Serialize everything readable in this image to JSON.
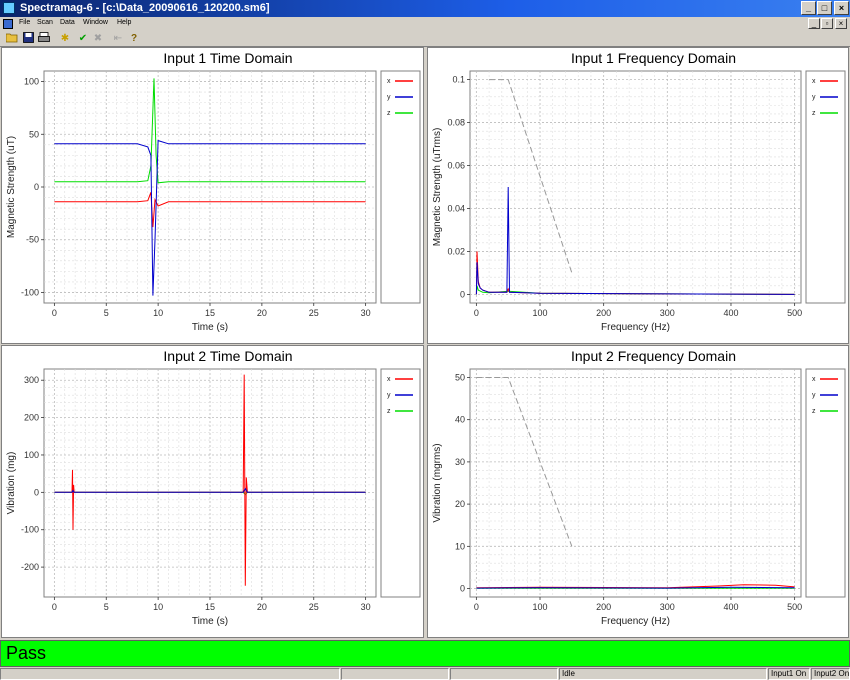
{
  "window": {
    "title": "Spectramag-6 - [c:\\Data_20090616_120200.sm6]"
  },
  "menu": {
    "items": [
      "File",
      "Scan",
      "Data",
      "Window",
      "Help"
    ]
  },
  "toolbar": {
    "icons": [
      "open-icon",
      "save-icon",
      "print-icon",
      "scan-icon",
      "check-icon",
      "cancel-icon",
      "step-icon",
      "help-icon"
    ]
  },
  "status": {
    "result": "Pass",
    "state": "Idle",
    "input1": "Input1 On",
    "input2": "Input2 On"
  },
  "colors": {
    "x": "#ff0000",
    "y": "#0000cc",
    "z": "#00dd00",
    "pass": "#00ff00"
  },
  "chart_data": [
    {
      "type": "line",
      "title": "Input 1 Time Domain",
      "xlabel": "Time (s)",
      "ylabel": "Magnetic Strength (uT)",
      "xlim": [
        -1,
        31
      ],
      "ylim": [
        -110,
        110
      ],
      "xticks": [
        "0",
        "5",
        "10",
        "15",
        "20",
        "25",
        "30"
      ],
      "yticks": [
        "-100",
        "-50",
        "0",
        "50",
        "100"
      ],
      "legend": [
        "x",
        "y",
        "z"
      ],
      "series": [
        {
          "name": "x",
          "x": [
            0,
            8,
            9,
            9.3,
            9.5,
            9.7,
            10,
            11,
            30
          ],
          "y": [
            -14,
            -14,
            -13,
            -5,
            -38,
            -12,
            -18,
            -14,
            -14
          ]
        },
        {
          "name": "y",
          "x": [
            0,
            8,
            9,
            9.3,
            9.5,
            9.7,
            10,
            11,
            30
          ],
          "y": [
            41,
            41,
            38,
            30,
            -103,
            -50,
            44,
            41,
            41
          ]
        },
        {
          "name": "z",
          "x": [
            0,
            8,
            9,
            9.3,
            9.6,
            9.8,
            10,
            11,
            30
          ],
          "y": [
            5,
            5,
            6,
            20,
            103,
            30,
            4,
            5,
            5
          ]
        }
      ]
    },
    {
      "type": "line",
      "title": "Input 1 Frequency Domain",
      "xlabel": "Frequency (Hz)",
      "ylabel": "Magnetic Strength (uTrms)",
      "xlim": [
        -10,
        510
      ],
      "ylim": [
        -0.004,
        0.104
      ],
      "xticks": [
        "0",
        "100",
        "200",
        "300",
        "400",
        "500"
      ],
      "yticks": [
        "0",
        "0.02",
        "0.04",
        "0.06",
        "0.08",
        "0.1"
      ],
      "legend": [
        "x",
        "y",
        "z"
      ],
      "series": [
        {
          "name": "x",
          "x": [
            0,
            1,
            3,
            6,
            10,
            20,
            48,
            50,
            52,
            100,
            500
          ],
          "y": [
            0,
            0.02,
            0.006,
            0.003,
            0.002,
            0.001,
            0.001,
            0.0025,
            0.001,
            0.0005,
            0
          ]
        },
        {
          "name": "y",
          "x": [
            0,
            1,
            3,
            6,
            10,
            20,
            48,
            50,
            52,
            100,
            500
          ],
          "y": [
            0,
            0.015,
            0.005,
            0.003,
            0.002,
            0.001,
            0.001,
            0.05,
            0.001,
            0.0005,
            0
          ]
        },
        {
          "name": "z",
          "x": [
            0,
            1,
            3,
            10,
            20,
            50,
            100,
            500
          ],
          "y": [
            0,
            0.004,
            0.002,
            0.001,
            0.0008,
            0.0015,
            0.0005,
            0
          ]
        }
      ],
      "reference": {
        "x": [
          20,
          50,
          150
        ],
        "y": [
          0.1,
          0.1,
          0.01
        ]
      }
    },
    {
      "type": "line",
      "title": "Input 2 Time Domain",
      "xlabel": "Time (s)",
      "ylabel": "Vibration (mg)",
      "xlim": [
        -1,
        31
      ],
      "ylim": [
        -280,
        330
      ],
      "xticks": [
        "0",
        "5",
        "10",
        "15",
        "20",
        "25",
        "30"
      ],
      "yticks": [
        "-200",
        "-100",
        "0",
        "100",
        "200",
        "300"
      ],
      "legend": [
        "x",
        "y",
        "z"
      ],
      "series": [
        {
          "name": "x",
          "x": [
            0,
            1.7,
            1.75,
            1.8,
            1.85,
            1.9,
            18.2,
            18.3,
            18.4,
            18.5,
            18.6,
            30
          ],
          "y": [
            0,
            0,
            60,
            -100,
            20,
            0,
            0,
            315,
            -250,
            40,
            0,
            0
          ]
        },
        {
          "name": "y",
          "x": [
            0,
            1.7,
            1.8,
            1.9,
            18.2,
            18.4,
            18.6,
            30
          ],
          "y": [
            0,
            0,
            5,
            0,
            0,
            10,
            0,
            0
          ]
        },
        {
          "name": "z",
          "x": [
            0,
            18.2,
            18.4,
            18.6,
            30
          ],
          "y": [
            0,
            0,
            -6,
            0,
            0
          ]
        }
      ]
    },
    {
      "type": "line",
      "title": "Input 2 Frequency Domain",
      "xlabel": "Frequency (Hz)",
      "ylabel": "Vibration (mgrms)",
      "xlim": [
        -10,
        510
      ],
      "ylim": [
        -2,
        52
      ],
      "xticks": [
        "0",
        "100",
        "200",
        "300",
        "400",
        "500"
      ],
      "yticks": [
        "0",
        "10",
        "20",
        "30",
        "40",
        "50"
      ],
      "legend": [
        "x",
        "y",
        "z"
      ],
      "series": [
        {
          "name": "x",
          "x": [
            0,
            100,
            300,
            380,
            420,
            470,
            500
          ],
          "y": [
            0.2,
            0.3,
            0.2,
            0.6,
            0.9,
            0.8,
            0.4
          ]
        },
        {
          "name": "y",
          "x": [
            0,
            100,
            300,
            400,
            500
          ],
          "y": [
            0.1,
            0.2,
            0.1,
            0.3,
            0.2
          ]
        },
        {
          "name": "z",
          "x": [
            0,
            500
          ],
          "y": [
            0.05,
            0.05
          ]
        }
      ],
      "reference": {
        "x": [
          0,
          50,
          150
        ],
        "y": [
          50,
          50,
          10
        ]
      }
    }
  ]
}
